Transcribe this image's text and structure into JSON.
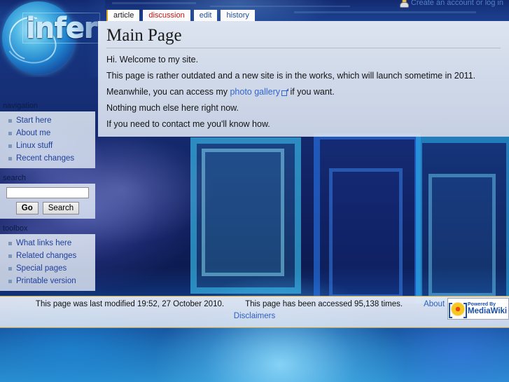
{
  "site": {
    "logo_text": "infer",
    "logo_alt": "infernix-logo"
  },
  "personal": {
    "icon": "user-icon",
    "links_text": "Create an account or log in"
  },
  "tabs": [
    {
      "label": "article",
      "state": "selected",
      "name": "tab-article"
    },
    {
      "label": "discussion",
      "state": "new",
      "name": "tab-discussion"
    },
    {
      "label": "edit",
      "state": "normal",
      "name": "tab-edit"
    },
    {
      "label": "history",
      "state": "normal",
      "name": "tab-history"
    }
  ],
  "content": {
    "title": "Main Page",
    "paragraphs": {
      "p1": "Hi. Welcome to my site.",
      "p2": "This page is rather outdated and a new site is in the works, which will launch sometime in 2011.",
      "p3_before": "Meanwhile, you can access my ",
      "p3_link": "photo gallery",
      "p3_after": " if you want.",
      "p4": "Nothing much else here right now.",
      "p5": "If you need to contact me you'll know how."
    }
  },
  "sidebar": {
    "navigation": {
      "heading": "navigation",
      "items": [
        {
          "label": "Start here"
        },
        {
          "label": "About me"
        },
        {
          "label": "Linux stuff"
        },
        {
          "label": "Recent changes"
        }
      ]
    },
    "search": {
      "heading": "search",
      "value": "",
      "placeholder": "",
      "go_label": "Go",
      "search_label": "Search"
    },
    "toolbox": {
      "heading": "toolbox",
      "items": [
        {
          "label": "What links here"
        },
        {
          "label": "Related changes"
        },
        {
          "label": "Special pages"
        },
        {
          "label": "Printable version"
        }
      ]
    }
  },
  "footer": {
    "last_modified": "This page was last modified 19:52, 27 October 2010.",
    "views": "This page has been accessed 95,138 times.",
    "about": "About Infernix",
    "disclaimers": "Disclaimers",
    "badge_line1": "Powered By",
    "badge_line2": "MediaWiki",
    "badge_icon": "mediawiki-sunflower-icon"
  },
  "colors": {
    "accent_gold": "#c8a23a",
    "link_blue": "#21409a",
    "new_link_red": "#c81414",
    "bg_deep_blue": "#0d1f6b"
  }
}
